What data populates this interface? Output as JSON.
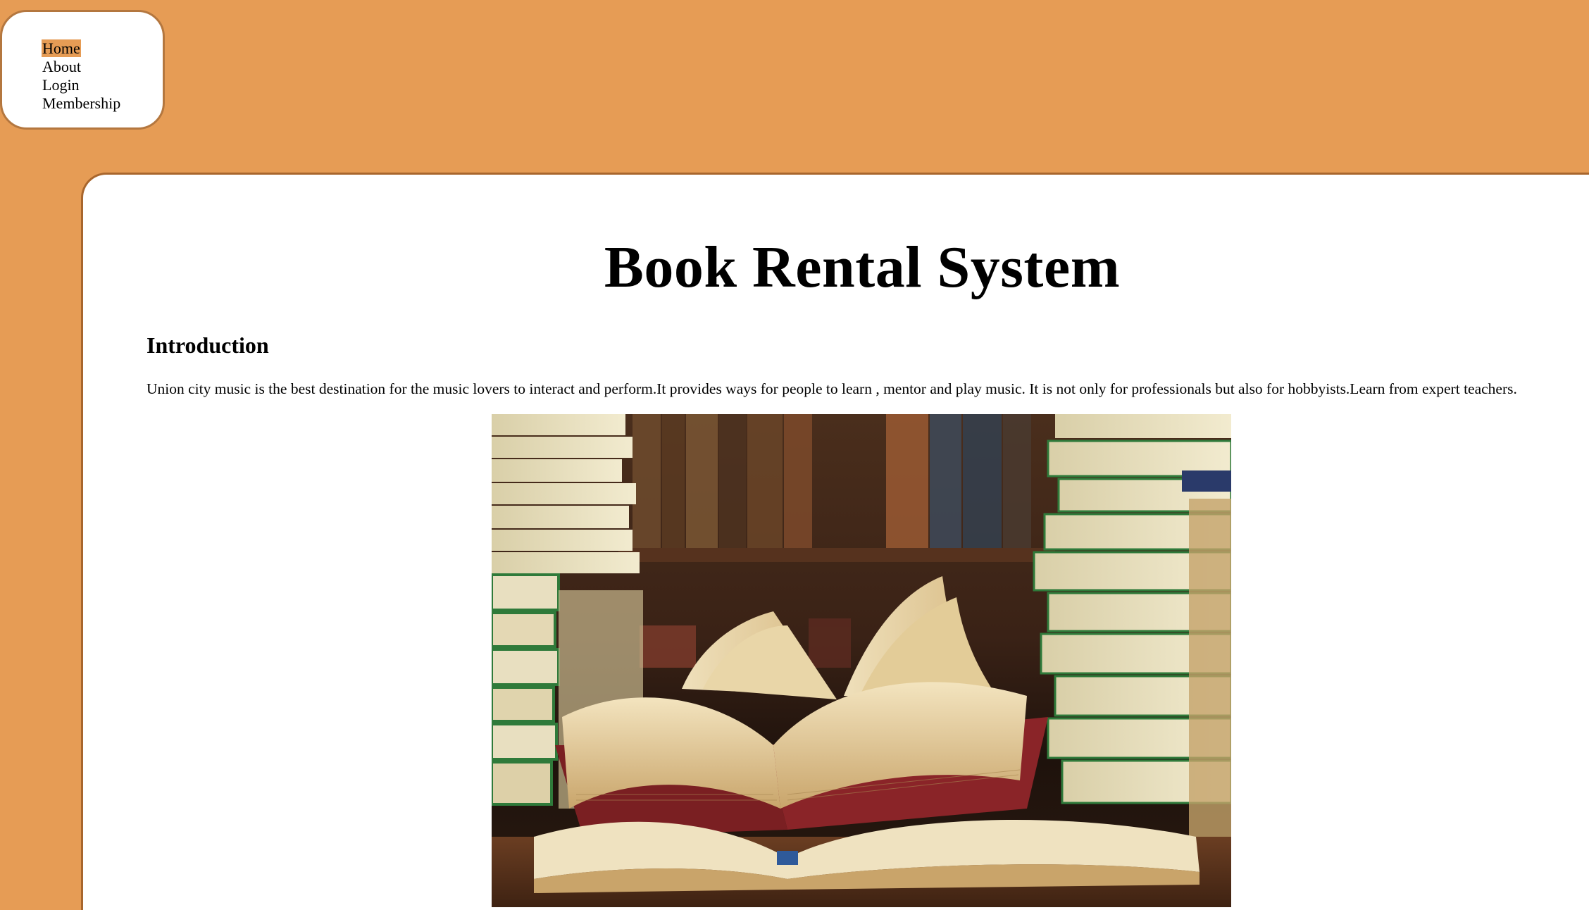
{
  "nav": {
    "items": [
      {
        "label": "Home",
        "active": true
      },
      {
        "label": "About",
        "active": false
      },
      {
        "label": "Login",
        "active": false
      },
      {
        "label": "Membership",
        "active": false
      }
    ]
  },
  "main": {
    "title": "Book Rental System",
    "section_heading": "Introduction",
    "intro_text": "Union city music is the best destination for the music lovers to interact and perform.It provides ways for people to learn , mentor and play music. It is not only for professionals but also for hobbyists.Learn from expert teachers.",
    "image_caption": ""
  },
  "colors": {
    "background": "#e69c55",
    "panel": "#ffffff",
    "border": "#a8662d",
    "active_highlight": "#e69c55"
  }
}
